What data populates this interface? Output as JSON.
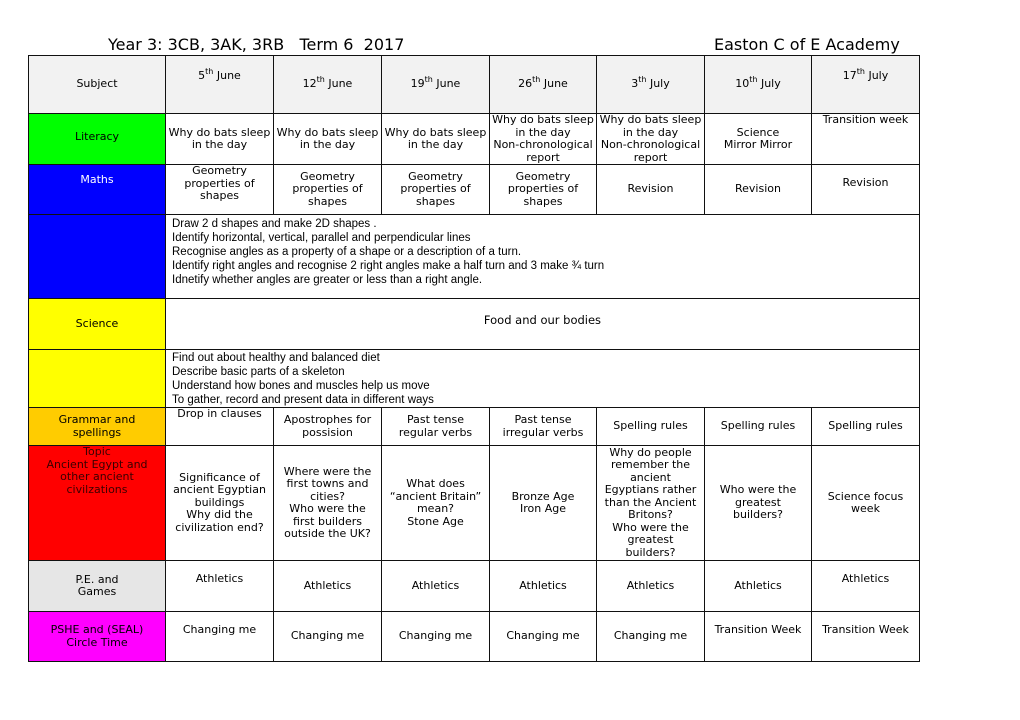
{
  "document": {
    "title_left": "Year 3: 3CB, 3AK, 3RB   Term 6  2017",
    "title_right": "Easton C of E Academy"
  },
  "header": {
    "subject_label": "Subject",
    "weeks": [
      {
        "num": "5",
        "sup": "th",
        "month": " June"
      },
      {
        "num": "12",
        "sup": "th",
        "month": " June"
      },
      {
        "num": "19",
        "sup": "th",
        "month": " June"
      },
      {
        "num": "26",
        "sup": "th",
        "month": " June"
      },
      {
        "num": "3",
        "sup": "th",
        "month": " July"
      },
      {
        "num": "10",
        "sup": "th",
        "month": " July"
      },
      {
        "num": "17",
        "sup": "th",
        "month": " July"
      }
    ]
  },
  "colors": {
    "literacy": "#00ff00",
    "maths": "#0000ff",
    "science": "#ffff00",
    "grammar": "#ffcc00",
    "topic": "#ff0000",
    "pe": "#e6e6e6",
    "pshe": "#ff00ff",
    "header": "#f2f2f2"
  },
  "rows": {
    "literacy": {
      "subject": "Literacy",
      "cells": [
        [
          "Why do bats sleep",
          "in the day"
        ],
        [
          "Why do bats sleep",
          "in the day"
        ],
        [
          "Why do bats sleep",
          "in the day"
        ],
        [
          "Why do bats sleep",
          "in the day",
          "Non-chronological",
          "report"
        ],
        [
          "Why do bats sleep",
          "in the day",
          "Non-chronological",
          "report"
        ],
        [
          "Science",
          "Mirror Mirror"
        ],
        [
          "Transition week"
        ]
      ]
    },
    "maths": {
      "subject": "Maths",
      "cells": [
        [
          "Geometry",
          "properties of",
          "shapes"
        ],
        [
          "Geometry",
          "properties of",
          "shapes"
        ],
        [
          "Geometry",
          "properties of",
          "shapes"
        ],
        [
          "Geometry",
          "properties of",
          "shapes"
        ],
        [
          "Revision"
        ],
        [
          "Revision"
        ],
        [
          "Revision"
        ]
      ],
      "objectives": [
        "Draw 2 d shapes and make 2D shapes .",
        "Identify horizontal, vertical, parallel and perpendicular lines",
        "Recognise angles as a property of a shape or a description of a turn.",
        "Identify right angles and recognise 2 right angles make a half turn and 3 make ¾ turn",
        "Idnetify whether angles are greater or less than a right angle."
      ]
    },
    "science": {
      "subject": "Science",
      "topic": "Food and our bodies",
      "objectives": [
        "Find out about healthy and balanced diet",
        "Describe basic parts of a skeleton",
        "Understand how bones and muscles help us move",
        "To gather, record and present data in different ways"
      ]
    },
    "grammar": {
      "subject": [
        "Grammar and",
        "spellings"
      ],
      "cells": [
        [
          "Drop in clauses"
        ],
        [
          "Apostrophes for",
          "possision"
        ],
        [
          "Past tense",
          "regular verbs"
        ],
        [
          "Past tense",
          "irregular verbs"
        ],
        [
          "Spelling rules"
        ],
        [
          "Spelling rules"
        ],
        [
          "Spelling rules"
        ]
      ]
    },
    "topic": {
      "subject": [
        "Topic",
        "Ancient Egypt and",
        "other ancient",
        "civilzations"
      ],
      "cells": [
        [
          "Significance of",
          "ancient Egyptian",
          "buildings",
          "Why did the",
          "civilization end?"
        ],
        [
          "Where were the",
          "first towns and",
          "cities?",
          "Who were the",
          "first builders",
          "outside the UK?"
        ],
        [
          "What does",
          "“ancient Britain”",
          "mean?",
          "Stone Age"
        ],
        [
          "Bronze Age",
          "Iron Age"
        ],
        [
          "Why do people",
          "remember the",
          "ancient",
          "Egyptians rather",
          "than the Ancient",
          "Britons?",
          "Who were the",
          "greatest",
          "builders?"
        ],
        [
          "Who were the",
          "greatest",
          "builders?"
        ],
        [
          "Science focus",
          "week"
        ]
      ]
    },
    "pe": {
      "subject": [
        "P.E. and",
        "Games"
      ],
      "cells": [
        [
          "Athletics"
        ],
        [
          "Athletics"
        ],
        [
          "Athletics"
        ],
        [
          "Athletics"
        ],
        [
          "Athletics"
        ],
        [
          "Athletics"
        ],
        [
          "Athletics"
        ]
      ]
    },
    "pshe": {
      "subject": [
        "PSHE and (SEAL)",
        "Circle Time"
      ],
      "cells": [
        [
          "Changing me"
        ],
        [
          "Changing me"
        ],
        [
          "Changing me"
        ],
        [
          "Changing me"
        ],
        [
          "Changing me"
        ],
        [
          "Transition Week"
        ],
        [
          "Transition Week"
        ]
      ]
    }
  }
}
